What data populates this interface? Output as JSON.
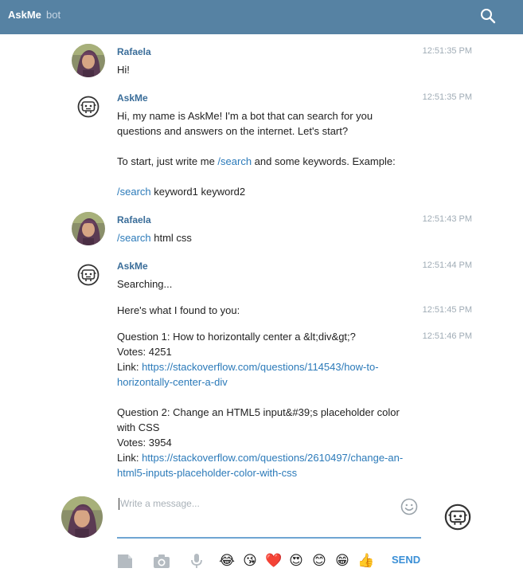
{
  "header": {
    "app_name": "AskMe",
    "subtitle": "bot"
  },
  "messages": {
    "m1": {
      "sender": "Rafaela",
      "time": "12:51:35 PM",
      "text": "Hi!"
    },
    "m2": {
      "sender": "AskMe",
      "time": "12:51:35 PM",
      "line1": "Hi, my name is AskMe! I'm a bot that can search for you",
      "line2": "questions and answers on the internet. Let's start?",
      "start_prefix": "To start, just write me ",
      "start_cmd": "/search",
      "start_suffix": " and some keywords. Example:",
      "example_cmd": "/search",
      "example_args": " keyword1 keyword2"
    },
    "m3": {
      "sender": "Rafaela",
      "time": "12:51:43 PM",
      "cmd": "/search",
      "args": " html css"
    },
    "m4": {
      "sender": "AskMe",
      "time": "12:51:44 PM",
      "text": "Searching..."
    },
    "m5": {
      "time": "12:51:45 PM",
      "text": "Here's what I found to you:"
    },
    "m6": {
      "time": "12:51:46 PM",
      "q1_title": "Question 1: How to horizontally center a &lt;div&gt;?",
      "q1_votes": "Votes: 4251",
      "q1_link_label": "Link: ",
      "q1_link_line1": "https://stackoverflow.com/questions/114543/how-to-",
      "q1_link_line2": "horizontally-center-a-div",
      "q2_title_line1": "Question 2: Change an HTML5 input&#39;s placeholder color",
      "q2_title_line2": "with CSS",
      "q2_votes": "Votes: 3954",
      "q2_link_label": "Link: ",
      "q2_link_line1": "https://stackoverflow.com/questions/2610497/change-an-",
      "q2_link_line2": "html5-inputs-placeholder-color-with-css"
    }
  },
  "composer": {
    "placeholder": "Write a message...",
    "send_label": "SEND",
    "emojis": [
      "😂",
      "😘",
      "❤️",
      "😍",
      "😊",
      "😁",
      "👍"
    ]
  },
  "colors": {
    "header_bg": "#5682a3",
    "sender_name": "#3a6d99",
    "link": "#2b7ab9",
    "send": "#3a8fd6"
  },
  "icons": {
    "header": "search-icon",
    "composer": [
      "smile-icon",
      "file-icon",
      "camera-icon",
      "microphone-icon"
    ],
    "bot_avatar": "robot-icon"
  }
}
